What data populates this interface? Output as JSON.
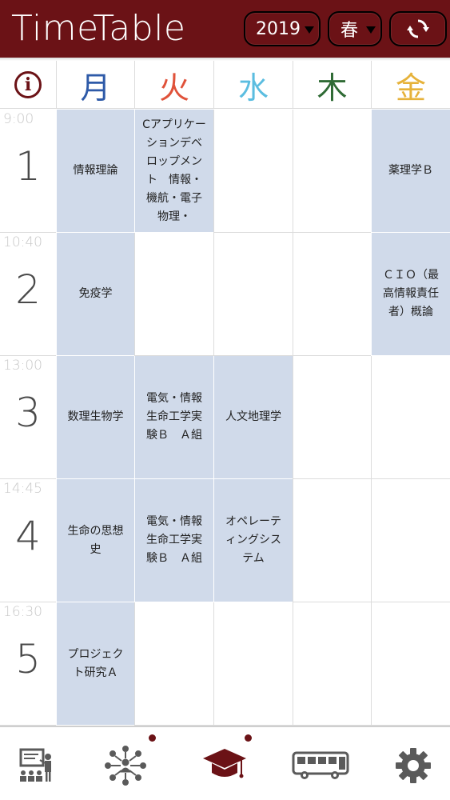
{
  "app": {
    "title": "TimeTable",
    "year": "2019",
    "term": "春",
    "accent": "#6b1216"
  },
  "days": [
    {
      "label": "月",
      "color": "#2e5aa8"
    },
    {
      "label": "火",
      "color": "#e0523a"
    },
    {
      "label": "水",
      "color": "#5bbde0"
    },
    {
      "label": "木",
      "color": "#2f6b35"
    },
    {
      "label": "金",
      "color": "#e6b23a"
    }
  ],
  "periods": [
    {
      "num": "1",
      "time": "9:00"
    },
    {
      "num": "2",
      "time": "10:40"
    },
    {
      "num": "3",
      "time": "13:00"
    },
    {
      "num": "4",
      "time": "14:45"
    },
    {
      "num": "5",
      "time": "16:30"
    }
  ],
  "classes": {
    "p1": [
      "情報理論",
      "Cアプリケーションデベロップメント　情報・機航・電子物理・",
      "",
      "",
      "薬理学Ｂ"
    ],
    "p2": [
      "免疫学",
      "",
      "",
      "",
      "ＣＩＯ（最高情報責任者）概論"
    ],
    "p3": [
      "数理生物学",
      "電気・情報生命工学実験Ｂ　Ａ組",
      "人文地理学",
      "",
      ""
    ],
    "p4": [
      "生命の思想史",
      "電気・情報生命工学実験Ｂ　Ａ組",
      "オペレーティングシステム",
      "",
      ""
    ],
    "p5": [
      "プロジェクト研究Ａ",
      "",
      "",
      "",
      ""
    ]
  },
  "nav": {
    "items": [
      {
        "icon": "lecture-icon",
        "notification": false
      },
      {
        "icon": "community-icon",
        "notification": true
      },
      {
        "icon": "graduation-cap-icon",
        "notification": true
      },
      {
        "icon": "bus-icon",
        "notification": false
      },
      {
        "icon": "gear-icon",
        "notification": false
      }
    ]
  }
}
